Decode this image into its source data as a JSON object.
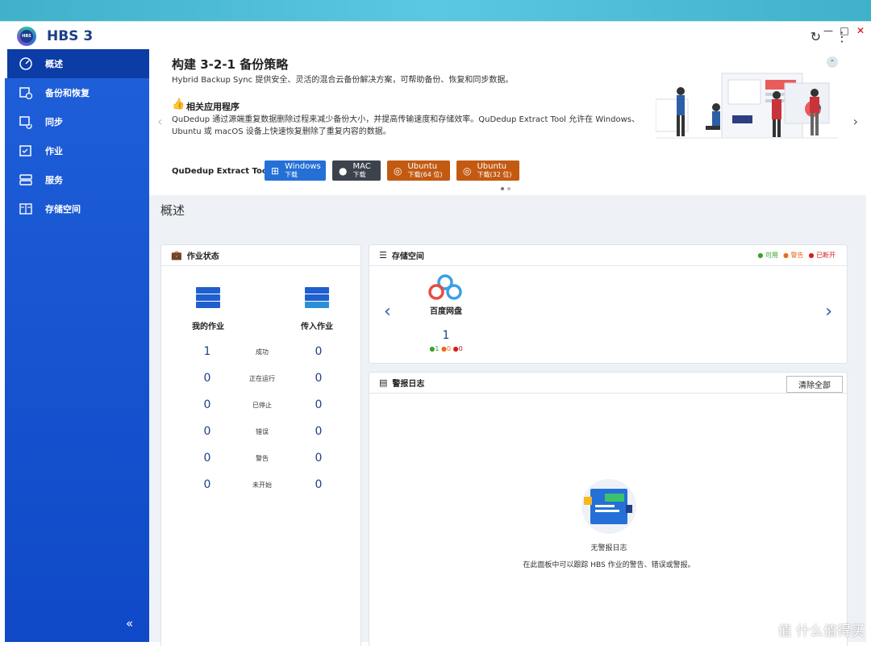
{
  "app": {
    "title": "HBS 3",
    "logo_text": "HBS"
  },
  "window_controls": [
    "—",
    "□",
    "✕"
  ],
  "sidebar": {
    "items": [
      {
        "label": "概述",
        "icon": "dashboard-icon",
        "active": true
      },
      {
        "label": "备份和恢复",
        "icon": "backup-restore-icon"
      },
      {
        "label": "同步",
        "icon": "sync-icon"
      },
      {
        "label": "作业",
        "icon": "jobs-icon"
      },
      {
        "label": "服务",
        "icon": "services-icon"
      },
      {
        "label": "存储空间",
        "icon": "storage-icon"
      }
    ],
    "collapse_label": "«"
  },
  "banner": {
    "title": "构建 3-2-1 备份策略",
    "subtitle": "Hybrid Backup Sync 提供安全、灵活的混合云备份解决方案，可帮助备份、恢复和同步数据。",
    "apps_heading": "相关应用程序",
    "description": "QuDedup 通过源端重复数据删除过程来减少备份大小，并提高传输速度和存储效率。QuDedup Extract Tool 允许在 Windows、Ubuntu 或 macOS 设备上快速恢复删除了重复内容的数据。",
    "tool_label": "QuDedup Extract Tool:",
    "buttons": [
      {
        "name": "Windows",
        "sub": "下载"
      },
      {
        "name": "MAC",
        "sub": "下载"
      },
      {
        "name": "Ubuntu",
        "sub": "下载(64 位)"
      },
      {
        "name": "Ubuntu",
        "sub": "下载(32 位)"
      }
    ]
  },
  "overview": {
    "title": "概述"
  },
  "jobs": {
    "title": "作业状态",
    "my_jobs": "我的作业",
    "incoming_jobs": "传入作业",
    "rows": [
      {
        "label": "成功",
        "mine": "1",
        "incoming": "0"
      },
      {
        "label": "正在运行",
        "mine": "0",
        "incoming": "0"
      },
      {
        "label": "已停止",
        "mine": "0",
        "incoming": "0"
      },
      {
        "label": "错误",
        "mine": "0",
        "incoming": "0"
      },
      {
        "label": "警告",
        "mine": "0",
        "incoming": "0"
      },
      {
        "label": "未开始",
        "mine": "0",
        "incoming": "0"
      }
    ]
  },
  "storage": {
    "title": "存储空间",
    "legend": {
      "available": "可用",
      "warning": "警告",
      "disconnected": "已断开"
    },
    "cloud": {
      "name": "百度网盘",
      "count": "1",
      "ok": "1",
      "warn": "0",
      "down": "0"
    }
  },
  "alerts": {
    "title": "警报日志",
    "clear_label": "清除全部",
    "empty_title": "无警报日志",
    "empty_desc": "在此面板中可以跟踪 HBS 作业的警告、错误或警报。"
  },
  "watermark": "值 什么值得买",
  "colors": {
    "sidebar": "#1f5fd9",
    "accent": "#2470d6",
    "ubuntu": "#c35a12",
    "mac": "#3c434d"
  }
}
